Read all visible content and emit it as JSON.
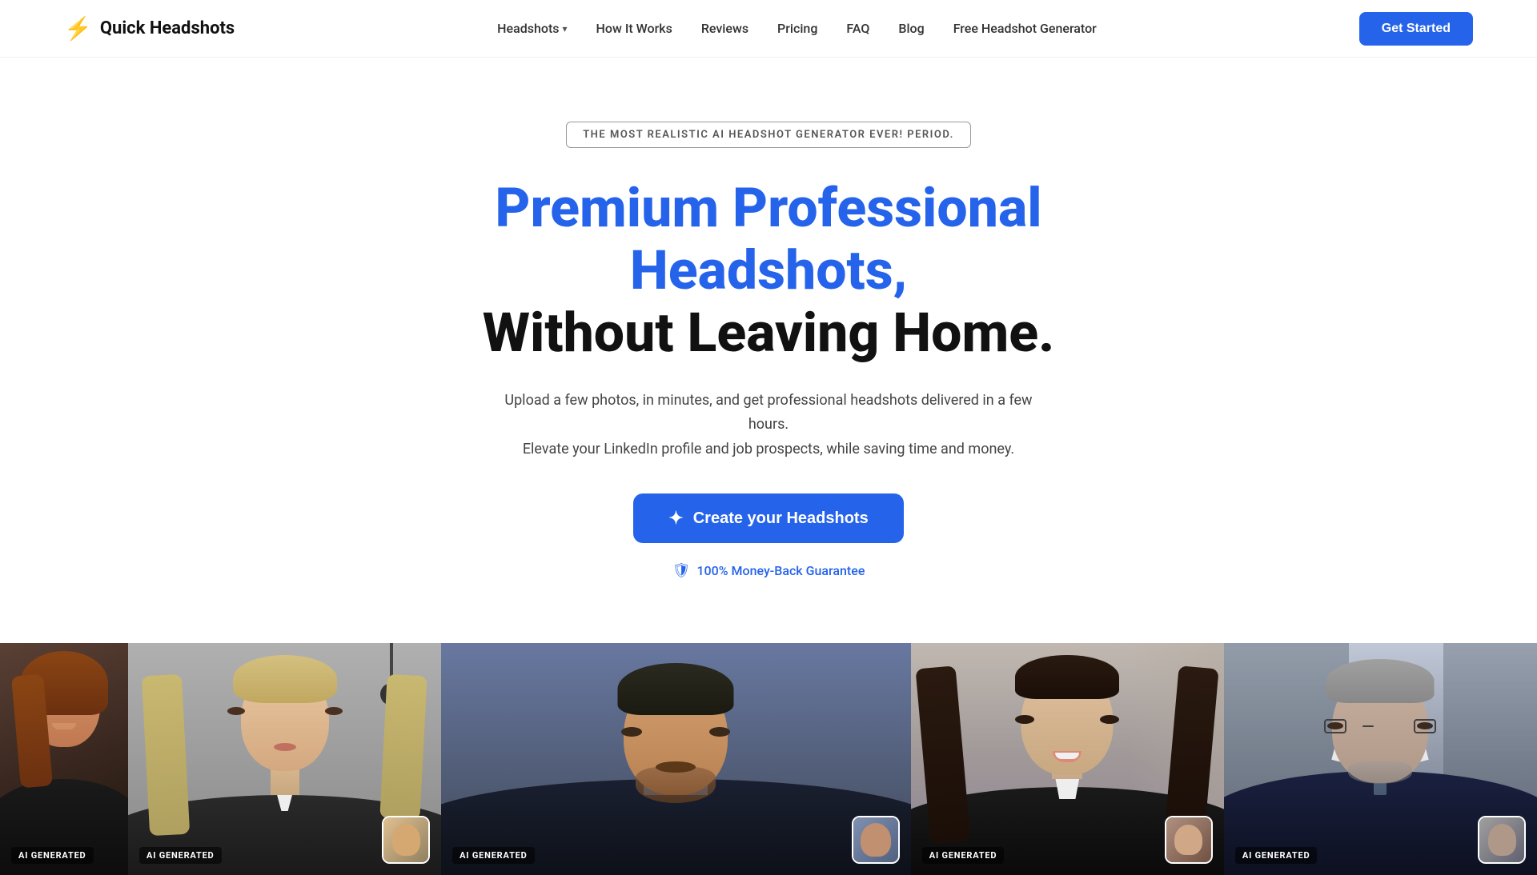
{
  "brand": {
    "name": "Quick Headshots",
    "icon": "⚡"
  },
  "nav": {
    "items": [
      {
        "label": "Headshots",
        "hasDropdown": true
      },
      {
        "label": "How It Works",
        "hasDropdown": false
      },
      {
        "label": "Reviews",
        "hasDropdown": false
      },
      {
        "label": "Pricing",
        "hasDropdown": false
      },
      {
        "label": "FAQ",
        "hasDropdown": false
      },
      {
        "label": "Blog",
        "hasDropdown": false
      },
      {
        "label": "Free Headshot Generator",
        "hasDropdown": false
      }
    ],
    "cta": "Get Started"
  },
  "hero": {
    "badge": "THE MOST REALISTIC AI HEADSHOT GENERATOR EVER! PERIOD.",
    "title_blue": "Premium Professional Headshots,",
    "title_dark": "Without Leaving Home.",
    "subtitle_line1": "Upload a few photos, in minutes, and get professional headshots delivered in a few hours.",
    "subtitle_line2": "Elevate your LinkedIn profile and job prospects, while saving time and money.",
    "cta_button": "Create your Headshots",
    "money_back": "100% Money-Back Guarantee"
  },
  "gallery": {
    "items": [
      {
        "label": "AI GENERATED",
        "hasThumbnail": false
      },
      {
        "label": "AI GENERATED",
        "hasThumbnail": true
      },
      {
        "label": "AI GENERATED",
        "hasThumbnail": true
      },
      {
        "label": "AI GENERATED",
        "hasThumbnail": true
      },
      {
        "label": "AI GENERATED",
        "hasThumbnail": true
      }
    ]
  }
}
